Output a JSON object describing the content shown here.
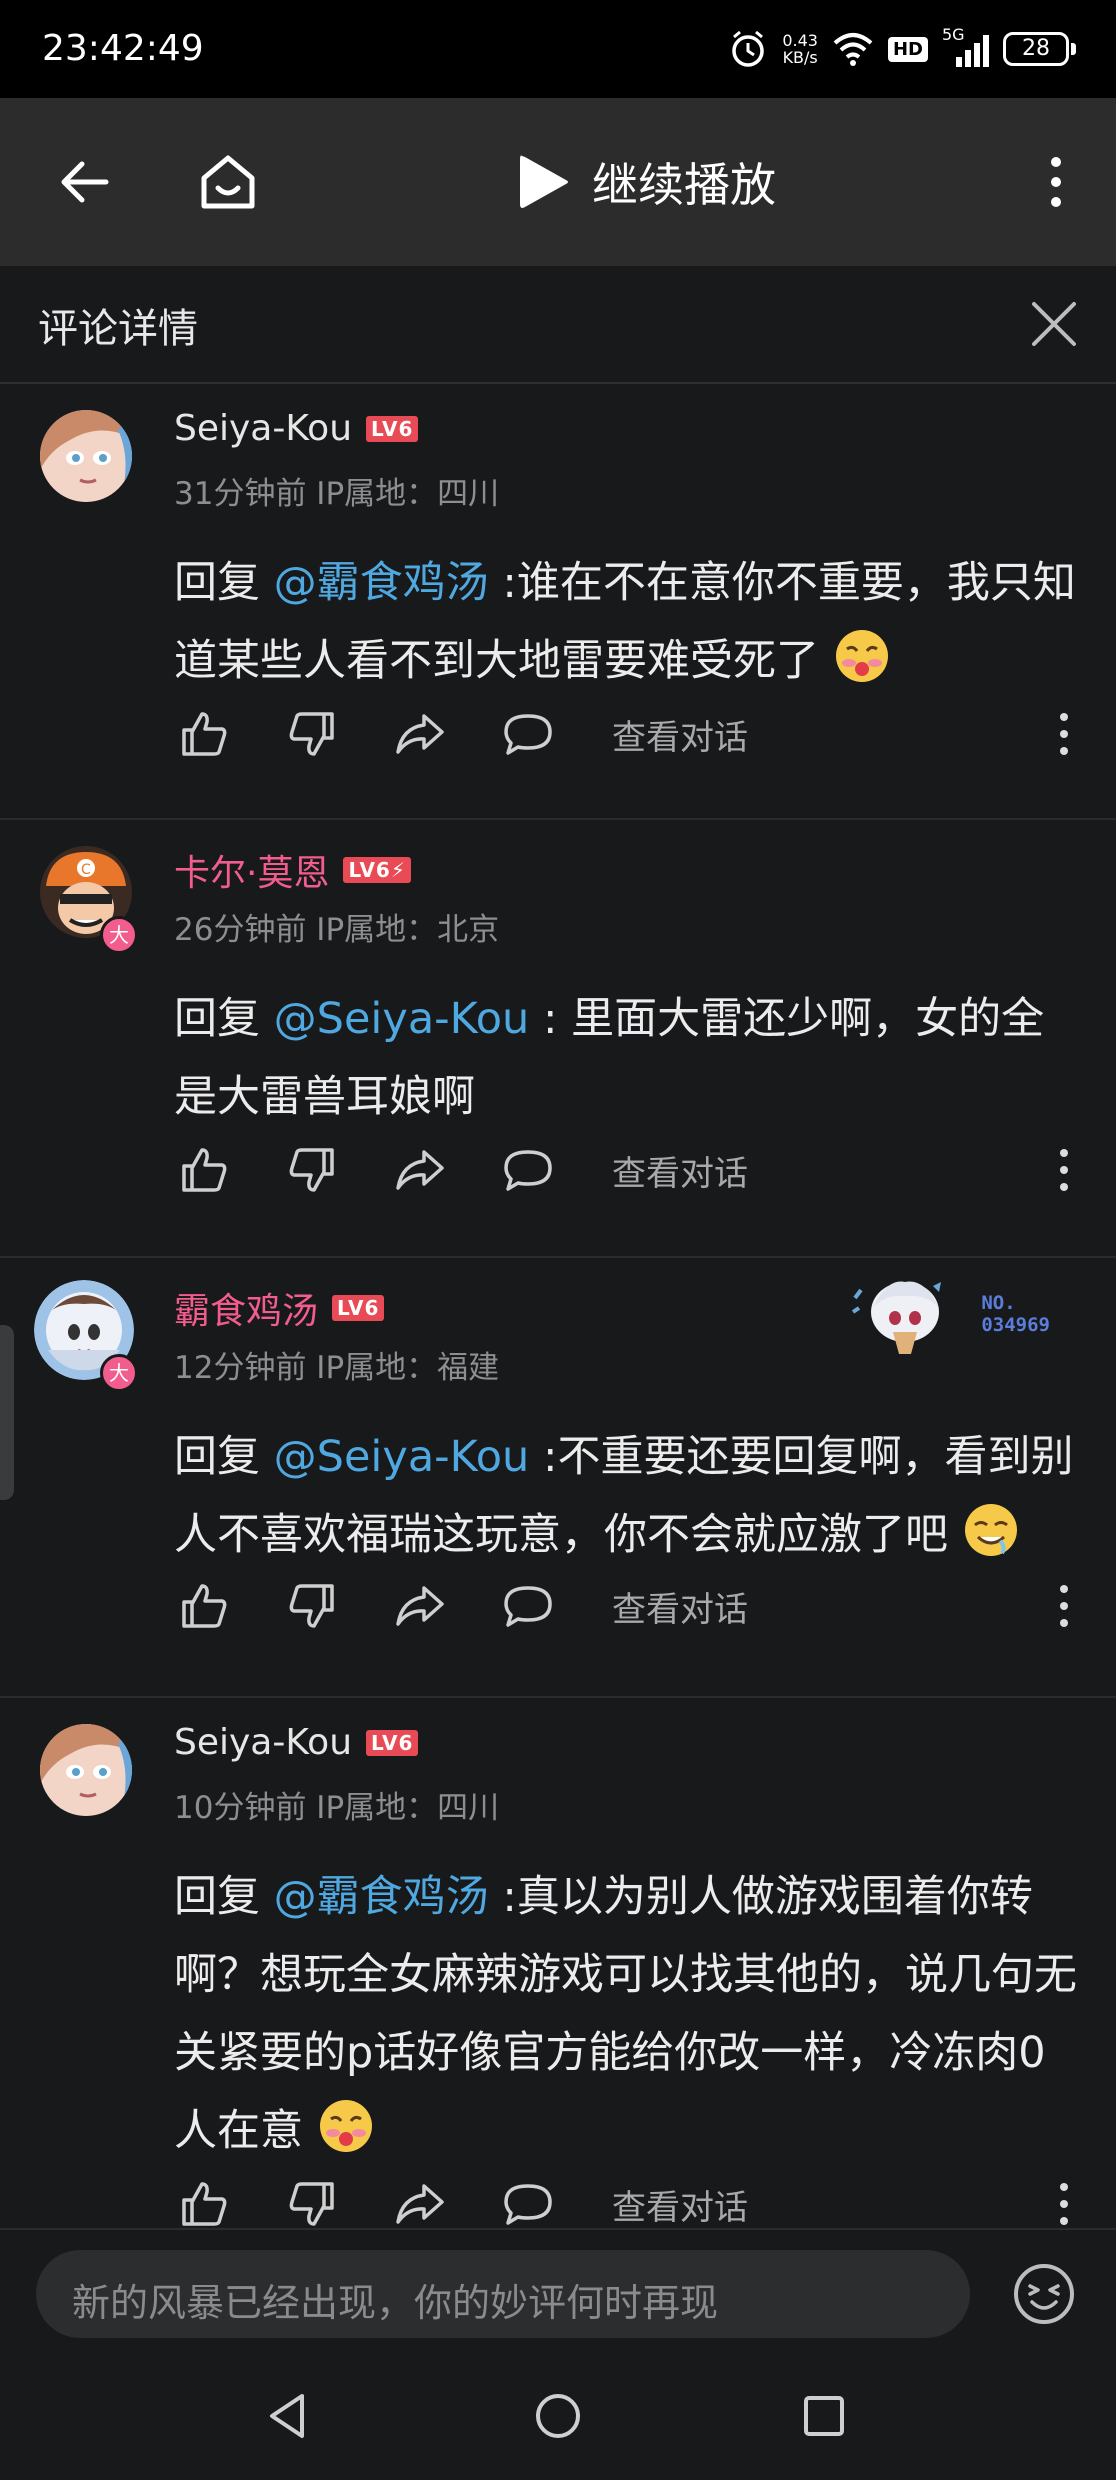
{
  "status_bar": {
    "time": "23:42:49",
    "net_speed_value": "0.43",
    "net_speed_unit": "KB/s",
    "hd_label": "HD",
    "network_label": "5G",
    "battery": "28"
  },
  "top_bar": {
    "play_label": "继续播放"
  },
  "sub_header": {
    "title": "评论详情"
  },
  "comments": [
    {
      "name": "Seiya-Kou",
      "name_color": "#e6e6e6",
      "level": "LV6",
      "meta": "31分钟前 IP属地：四川",
      "text_prefix": "回复 ",
      "mention": "@霸食鸡汤",
      "text": " :谁在不在意你不重要，我只知道某些人看不到大地雷要难受死了",
      "view_label": "查看对话"
    },
    {
      "name": "卡尔·莫恩",
      "name_color": "#f25d8e",
      "level": "LV6⚡",
      "avatar_badge": "大",
      "meta": "26分钟前 IP属地：北京",
      "text_prefix": "回复 ",
      "mention": "@Seiya-Kou",
      "text": " : 里面大雷还少啊，女的全是大雷兽耳娘啊",
      "view_label": "查看对话"
    },
    {
      "name": "霸食鸡汤",
      "name_color": "#f25d8e",
      "level": "LV6",
      "avatar_badge": "大",
      "nameplate_label": "NO.",
      "nameplate_number": "034969",
      "meta": "12分钟前 IP属地：福建",
      "text_prefix": "回复 ",
      "mention": "@Seiya-Kou",
      "text": " :不重要还要回复啊，看到别人不喜欢福瑞这玩意，你不会就应激了吧",
      "view_label": "查看对话"
    },
    {
      "name": "Seiya-Kou",
      "name_color": "#e6e6e6",
      "level": "LV6",
      "meta": "10分钟前 IP属地：四川",
      "text_prefix": "回复 ",
      "mention": "@霸食鸡汤",
      "text": " :真以为别人做游戏围着你转啊？想玩全女麻辣游戏可以找其他的，说几句无关紧要的p话好像官方能给你改一样，冷冻肉0人在意",
      "view_label": "查看对话"
    }
  ],
  "input": {
    "placeholder": "新的风暴已经出现，你的妙评何时再现"
  },
  "colors": {
    "accent_mention": "#4fa8e0",
    "vip_pink": "#f25d8e",
    "level_red": "#e84b55"
  }
}
